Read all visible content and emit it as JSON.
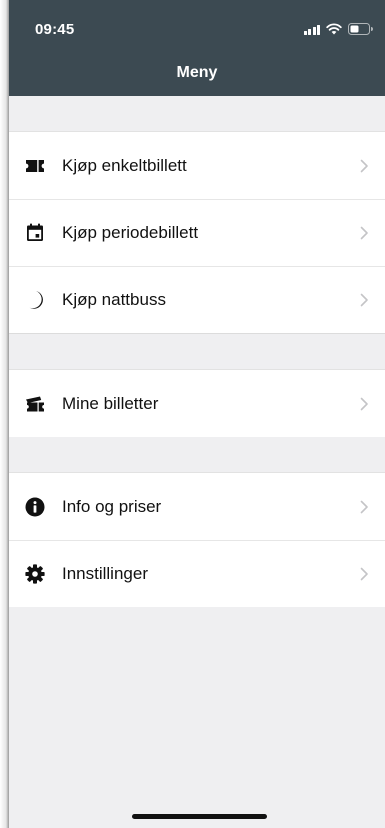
{
  "status_bar": {
    "time": "09:45"
  },
  "header": {
    "title": "Meny"
  },
  "sections": [
    {
      "items": [
        {
          "label": "Kjøp enkeltbillett",
          "icon": "ticket-icon"
        },
        {
          "label": "Kjøp periodebillett",
          "icon": "calendar-icon"
        },
        {
          "label": "Kjøp nattbuss",
          "icon": "moon-icon"
        }
      ]
    },
    {
      "items": [
        {
          "label": "Mine billetter",
          "icon": "tickets-stack-icon"
        }
      ]
    },
    {
      "items": [
        {
          "label": "Info og priser",
          "icon": "info-icon"
        },
        {
          "label": "Innstillinger",
          "icon": "gear-icon"
        }
      ]
    }
  ],
  "colors": {
    "header_bg": "#3c4a52",
    "page_bg": "#efeff1",
    "row_bg": "#ffffff",
    "icon": "#111111",
    "chevron": "#c4c4c7"
  }
}
